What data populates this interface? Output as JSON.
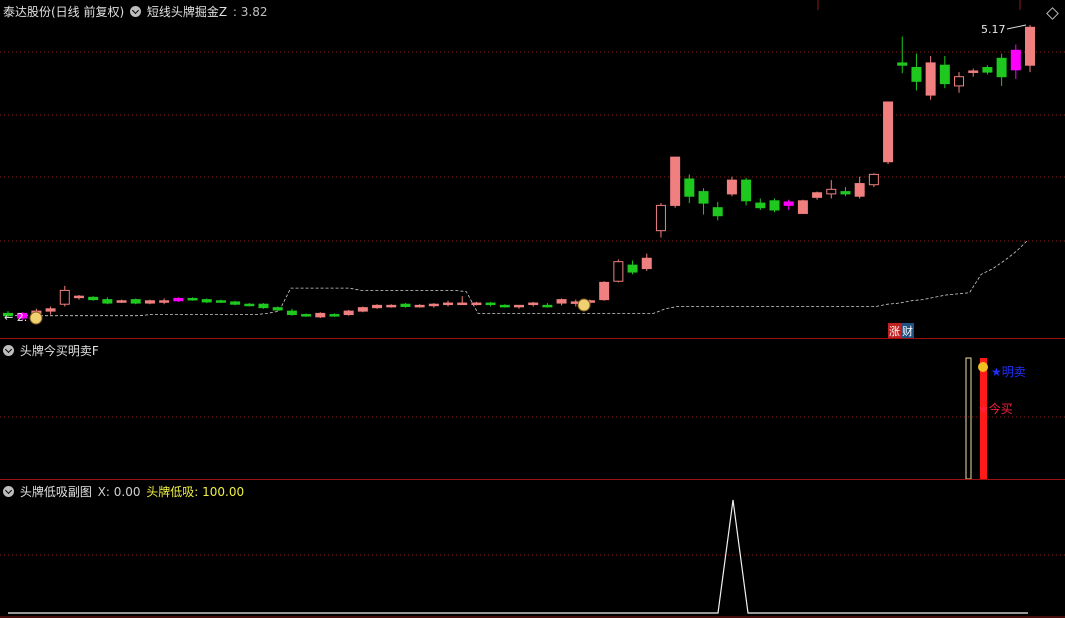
{
  "main": {
    "stock_label": "泰达股份(日线 前复权)",
    "indicator_name": "短线头牌掘金Z",
    "indicator_value_label": ": 3.82",
    "high_price_label": "5.17",
    "low_price_label": "← 2.",
    "badge_zhang": "涨",
    "badge_cai": "财",
    "colors": {
      "up": "#f08080",
      "down": "#1ec81e",
      "magenta": "#ff00ff",
      "grid": "#8b1a1a",
      "stop_line": "#d0d0d0"
    },
    "chart_data": {
      "type": "candlestick",
      "ohlc": [
        [
          2.66,
          2.68,
          2.62,
          2.64
        ],
        [
          2.62,
          2.67,
          2.6,
          2.66
        ],
        [
          2.66,
          2.7,
          2.63,
          2.68
        ],
        [
          2.68,
          2.72,
          2.65,
          2.7
        ],
        [
          2.74,
          2.9,
          2.72,
          2.86
        ],
        [
          2.8,
          2.82,
          2.78,
          2.81
        ],
        [
          2.8,
          2.81,
          2.77,
          2.78
        ],
        [
          2.78,
          2.8,
          2.74,
          2.75
        ],
        [
          2.77,
          2.78,
          2.75,
          2.77
        ],
        [
          2.78,
          2.79,
          2.74,
          2.75
        ],
        [
          2.75,
          2.78,
          2.74,
          2.77
        ],
        [
          2.76,
          2.79,
          2.74,
          2.77
        ],
        [
          2.77,
          2.8,
          2.76,
          2.79
        ],
        [
          2.79,
          2.8,
          2.77,
          2.78
        ],
        [
          2.78,
          2.79,
          2.75,
          2.76
        ],
        [
          2.77,
          2.78,
          2.75,
          2.76
        ],
        [
          2.76,
          2.77,
          2.73,
          2.74
        ],
        [
          2.74,
          2.75,
          2.72,
          2.73
        ],
        [
          2.74,
          2.75,
          2.7,
          2.71
        ],
        [
          2.71,
          2.72,
          2.68,
          2.69
        ],
        [
          2.68,
          2.7,
          2.64,
          2.65
        ],
        [
          2.65,
          2.66,
          2.63,
          2.64
        ],
        [
          2.63,
          2.67,
          2.62,
          2.66
        ],
        [
          2.65,
          2.66,
          2.63,
          2.64
        ],
        [
          2.65,
          2.69,
          2.64,
          2.68
        ],
        [
          2.68,
          2.72,
          2.67,
          2.71
        ],
        [
          2.71,
          2.74,
          2.7,
          2.73
        ],
        [
          2.72,
          2.74,
          2.71,
          2.73
        ],
        [
          2.74,
          2.75,
          2.71,
          2.72
        ],
        [
          2.72,
          2.74,
          2.71,
          2.73
        ],
        [
          2.73,
          2.75,
          2.71,
          2.74
        ],
        [
          2.74,
          2.77,
          2.72,
          2.75
        ],
        [
          2.75,
          2.81,
          2.74,
          2.75
        ],
        [
          2.75,
          2.76,
          2.73,
          2.75
        ],
        [
          2.75,
          2.76,
          2.72,
          2.74
        ],
        [
          2.73,
          2.74,
          2.71,
          2.72
        ],
        [
          2.72,
          2.73,
          2.7,
          2.73
        ],
        [
          2.74,
          2.76,
          2.72,
          2.75
        ],
        [
          2.73,
          2.75,
          2.71,
          2.72
        ],
        [
          2.75,
          2.79,
          2.73,
          2.78
        ],
        [
          2.75,
          2.78,
          2.72,
          2.76
        ],
        [
          2.76,
          2.78,
          2.74,
          2.77
        ],
        [
          2.78,
          2.94,
          2.77,
          2.93
        ],
        [
          2.94,
          3.13,
          2.93,
          3.11
        ],
        [
          3.08,
          3.12,
          3.0,
          3.02
        ],
        [
          3.05,
          3.18,
          3.03,
          3.14
        ],
        [
          3.38,
          3.62,
          3.32,
          3.6
        ],
        [
          3.6,
          4.02,
          3.58,
          4.02
        ],
        [
          3.83,
          3.87,
          3.62,
          3.68
        ],
        [
          3.72,
          3.75,
          3.52,
          3.62
        ],
        [
          3.58,
          3.63,
          3.47,
          3.51
        ],
        [
          3.7,
          3.85,
          3.68,
          3.82
        ],
        [
          3.82,
          3.84,
          3.6,
          3.64
        ],
        [
          3.62,
          3.66,
          3.56,
          3.58
        ],
        [
          3.64,
          3.66,
          3.54,
          3.56
        ],
        [
          3.6,
          3.65,
          3.56,
          3.63
        ],
        [
          3.53,
          3.65,
          3.53,
          3.64
        ],
        [
          3.67,
          3.72,
          3.65,
          3.71
        ],
        [
          3.7,
          3.82,
          3.66,
          3.74
        ],
        [
          3.72,
          3.76,
          3.68,
          3.7
        ],
        [
          3.68,
          3.85,
          3.66,
          3.79
        ],
        [
          3.78,
          3.88,
          3.76,
          3.87
        ],
        [
          3.98,
          4.5,
          3.96,
          4.5
        ],
        [
          4.84,
          5.07,
          4.75,
          4.82
        ],
        [
          4.8,
          4.92,
          4.6,
          4.68
        ],
        [
          4.56,
          4.9,
          4.52,
          4.84
        ],
        [
          4.82,
          4.9,
          4.62,
          4.66
        ],
        [
          4.64,
          4.76,
          4.58,
          4.72
        ],
        [
          4.76,
          4.79,
          4.72,
          4.77
        ],
        [
          4.8,
          4.82,
          4.74,
          4.76
        ],
        [
          4.88,
          4.92,
          4.64,
          4.72
        ],
        [
          4.78,
          5.0,
          4.7,
          4.95
        ],
        [
          4.82,
          5.17,
          4.76,
          5.15
        ]
      ],
      "magenta_indices": [
        1,
        12,
        55,
        71
      ],
      "up_on_down_indices": [
        4,
        13
      ],
      "stop_line": [
        2.64,
        2.64,
        2.64,
        2.64,
        2.64,
        2.64,
        2.64,
        2.64,
        2.64,
        2.64,
        2.64,
        2.64,
        2.65,
        2.65,
        2.65,
        2.65,
        2.65,
        2.65,
        2.65,
        2.65,
        2.65,
        2.65,
        2.66,
        2.68,
        2.88,
        2.88,
        2.88,
        2.88,
        2.88,
        2.88,
        2.86,
        2.86,
        2.86,
        2.86,
        2.86,
        2.86,
        2.86,
        2.86,
        2.86,
        2.85,
        2.66,
        2.66,
        2.66,
        2.66,
        2.66,
        2.66,
        2.66,
        2.66,
        2.66,
        2.66,
        2.66,
        2.66,
        2.66,
        2.66,
        2.66,
        2.66,
        2.7,
        2.72,
        2.72,
        2.72,
        2.72,
        2.72,
        2.72,
        2.72,
        2.72,
        2.72,
        2.72,
        2.72,
        2.72,
        2.72,
        2.72,
        2.72,
        2.72,
        2.72,
        2.72,
        2.74,
        2.75,
        2.77,
        2.78,
        2.8,
        2.82,
        2.83,
        2.84,
        3.0,
        3.05,
        3.12,
        3.2,
        3.3
      ]
    }
  },
  "sub1": {
    "name": "头牌今买明卖F",
    "signal_sell": "★明卖",
    "signal_buy": "★今买"
  },
  "sub2": {
    "name": "头牌低吸副图",
    "x_label": "X: 0.00",
    "value_label": "头牌低吸: 100.00"
  }
}
